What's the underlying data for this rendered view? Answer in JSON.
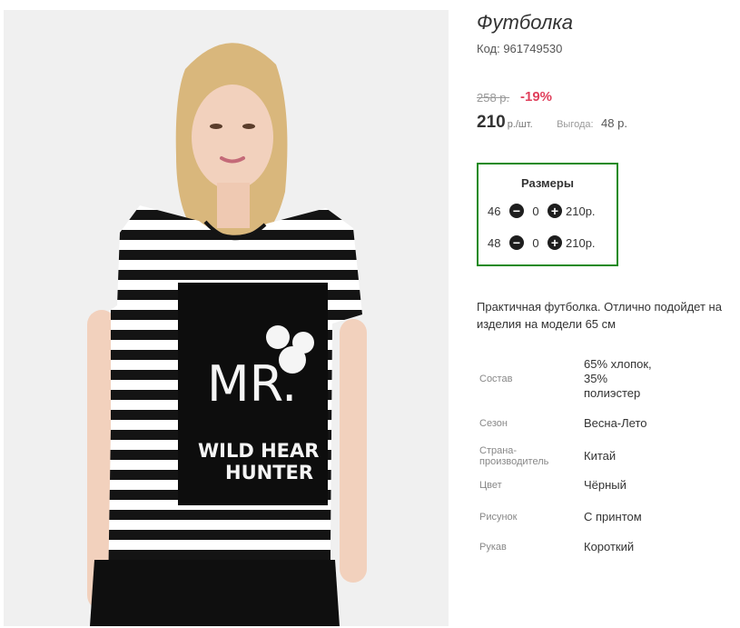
{
  "product": {
    "title": "Футболка",
    "code": "Код: 961749530",
    "old_price": "258 р.",
    "discount": "-19%",
    "price": "210",
    "unit": "р./шт.",
    "save_label": "Выгода:",
    "save_value": "48 р."
  },
  "sizes": {
    "title": "Размеры",
    "rows": [
      {
        "size": "46",
        "qty": "0",
        "price": "210р."
      },
      {
        "size": "48",
        "qty": "0",
        "price": "210р."
      }
    ]
  },
  "description": {
    "line1": "Практичная футболка. Отлично подойдет на",
    "line2": "изделия на модели 65 см"
  },
  "properties": [
    {
      "label": "Состав",
      "value": "65% хлопок, 35% полиэстер"
    },
    {
      "label": "Сезон",
      "value": "Весна-Лето"
    },
    {
      "label": "Страна-производитель",
      "value": "Китай"
    },
    {
      "label": "Цвет",
      "value": "Чёрный"
    },
    {
      "label": "Рисунок",
      "value": "С принтом"
    },
    {
      "label": "Рукав",
      "value": "Короткий"
    }
  ],
  "print": {
    "line1": "MR.",
    "line2": "WILD HEAR",
    "line3": "HUNTER"
  },
  "colors": {
    "discount": "#e0405c",
    "sizes_border": "#1a8a1a"
  }
}
